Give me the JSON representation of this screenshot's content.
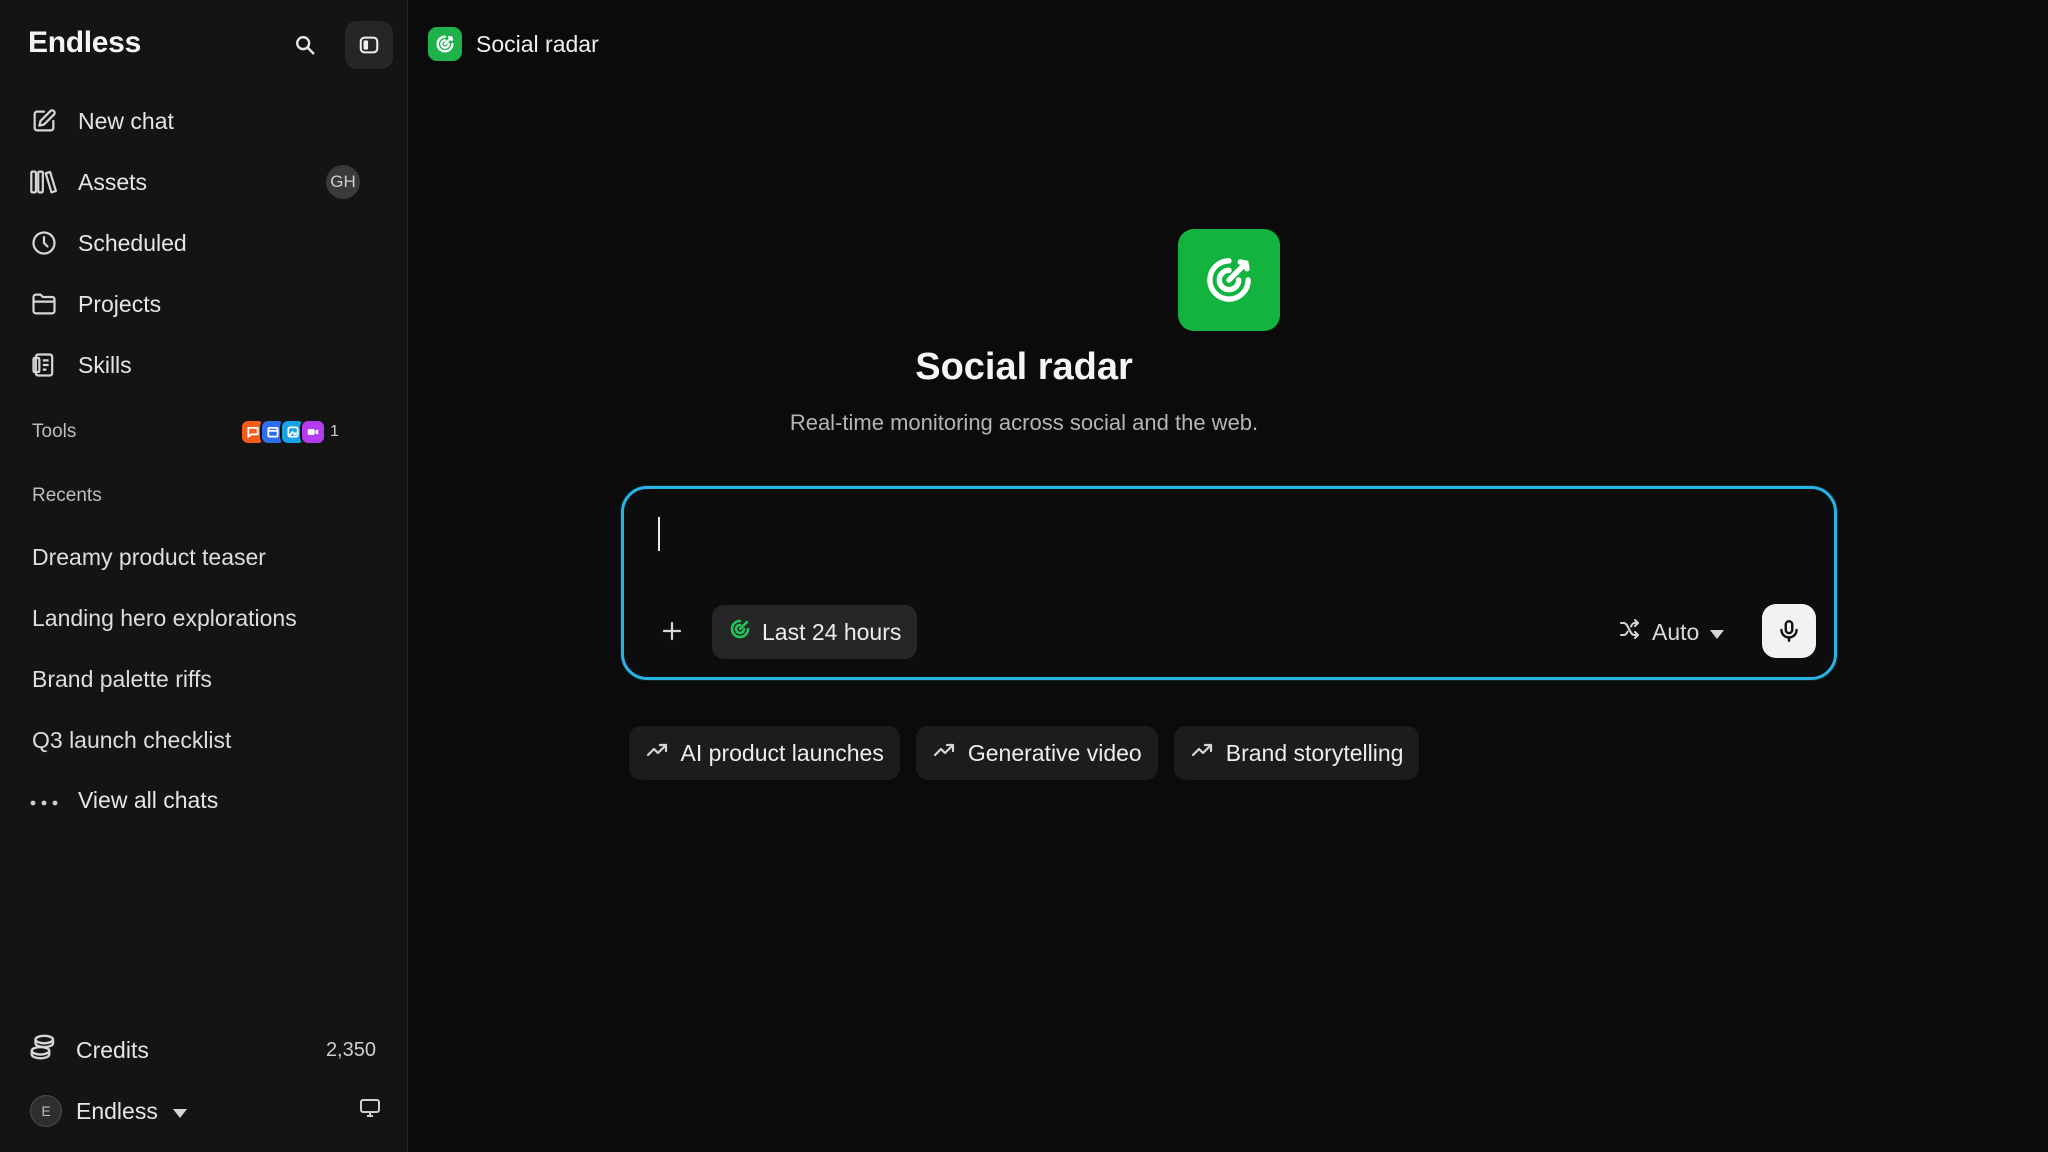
{
  "sidebar": {
    "brand": "Endless",
    "nav": [
      {
        "label": "New chat",
        "icon": "edit-icon"
      },
      {
        "label": "Assets",
        "icon": "library-icon",
        "badge": "GH"
      },
      {
        "label": "Scheduled",
        "icon": "clock-icon"
      },
      {
        "label": "Projects",
        "icon": "folder-icon"
      },
      {
        "label": "Skills",
        "icon": "skills-icon"
      }
    ],
    "tools_label": "Tools",
    "tools_extra_count": "1",
    "recents_label": "Recents",
    "recents": [
      "Dreamy product teaser",
      "Landing hero explorations",
      "Brand palette riffs",
      "Q3 launch checklist"
    ],
    "view_all": "View all chats",
    "credits_label": "Credits",
    "credits_value": "2,350",
    "account_initial": "E",
    "account_name": "Endless"
  },
  "header": {
    "app_name": "Social radar"
  },
  "hero": {
    "title": "Social radar",
    "subtitle": "Real-time monitoring across social and the web."
  },
  "composer": {
    "value": "",
    "time_filter": "Last 24 hours",
    "model": "Auto"
  },
  "suggestions": [
    "AI product launches",
    "Generative video",
    "Brand storytelling"
  ],
  "colors": {
    "accent_green": "#12b33f",
    "focus_blue": "#27b3e6",
    "background": "#0b0b0b",
    "sidebar": "#141414"
  }
}
